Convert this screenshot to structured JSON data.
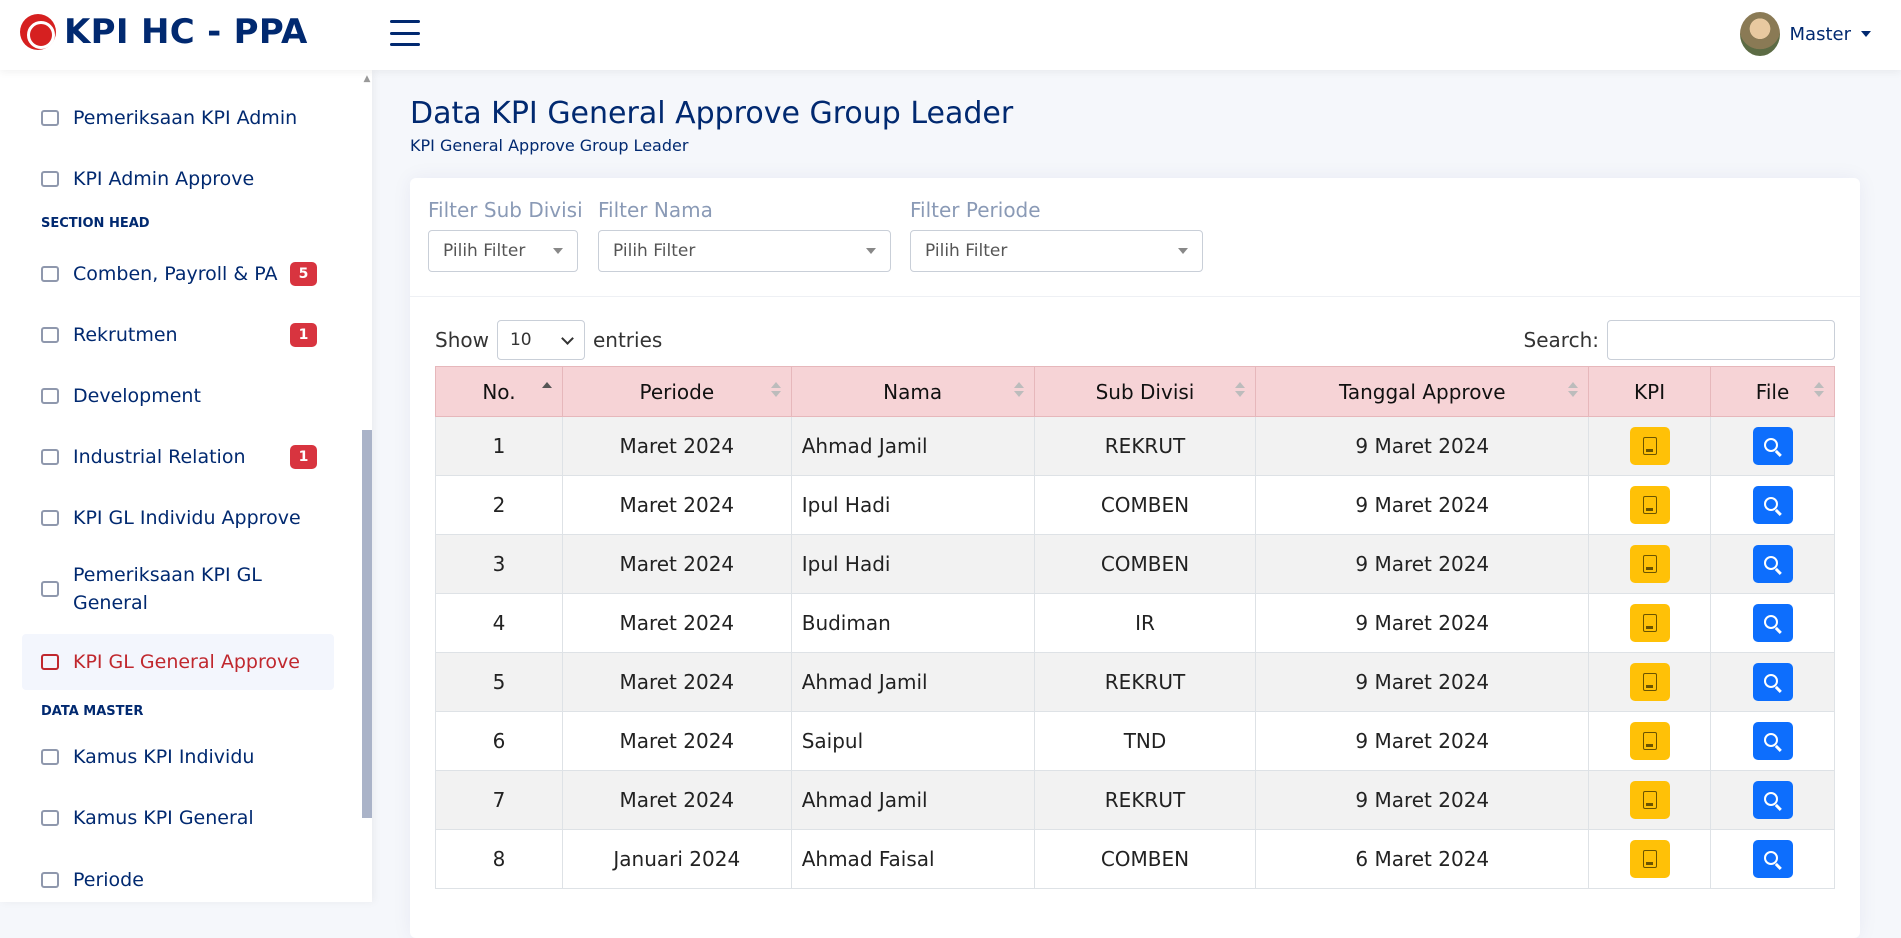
{
  "app": {
    "title": "KPI HC - PPA"
  },
  "user": {
    "name": "Master"
  },
  "sidebar": {
    "items": [
      {
        "label": "Pemeriksaan KPI Admin"
      },
      {
        "label": "KPI Admin Approve"
      },
      {
        "label": "Comben, Payroll & PA",
        "badge": "5"
      },
      {
        "label": "Rekrutmen",
        "badge": "1"
      },
      {
        "label": "Development"
      },
      {
        "label": "Industrial Relation",
        "badge": "1"
      },
      {
        "label": "KPI GL Individu Approve"
      },
      {
        "label": "Pemeriksaan KPI GL General"
      },
      {
        "label": "KPI GL General Approve"
      },
      {
        "label": "Kamus KPI Individu"
      },
      {
        "label": "Kamus KPI General"
      },
      {
        "label": "Periode"
      }
    ],
    "sections": {
      "section_head": "SECTION HEAD",
      "data_master": "DATA MASTER"
    },
    "active_color": "#c0282e"
  },
  "page": {
    "title": "Data KPI General Approve Group Leader",
    "subtitle": "KPI General Approve Group Leader"
  },
  "filters": {
    "sub_divisi": {
      "label": "Filter Sub Divisi",
      "value": "Pilih Filter"
    },
    "nama": {
      "label": "Filter Nama",
      "value": "Pilih Filter"
    },
    "periode": {
      "label": "Filter Periode",
      "value": "Pilih Filter"
    }
  },
  "table_controls": {
    "show_label": "Show",
    "entries_value": "10",
    "entries_label": "entries",
    "search_label": "Search:"
  },
  "table": {
    "columns": [
      "No.",
      "Periode",
      "Nama",
      "Sub Divisi",
      "Tanggal Approve",
      "KPI",
      "File"
    ],
    "rows": [
      {
        "no": "1",
        "periode": "Maret 2024",
        "nama": "Ahmad Jamil",
        "sub": "REKRUT",
        "tanggal": "9 Maret 2024"
      },
      {
        "no": "2",
        "periode": "Maret 2024",
        "nama": "Ipul Hadi",
        "sub": "COMBEN",
        "tanggal": "9 Maret 2024"
      },
      {
        "no": "3",
        "periode": "Maret 2024",
        "nama": "Ipul Hadi",
        "sub": "COMBEN",
        "tanggal": "9 Maret 2024"
      },
      {
        "no": "4",
        "periode": "Maret 2024",
        "nama": "Budiman",
        "sub": "IR",
        "tanggal": "9 Maret 2024"
      },
      {
        "no": "5",
        "periode": "Maret 2024",
        "nama": "Ahmad Jamil",
        "sub": "REKRUT",
        "tanggal": "9 Maret 2024"
      },
      {
        "no": "6",
        "periode": "Maret 2024",
        "nama": "Saipul",
        "sub": "TND",
        "tanggal": "9 Maret 2024"
      },
      {
        "no": "7",
        "periode": "Maret 2024",
        "nama": "Ahmad Jamil",
        "sub": "REKRUT",
        "tanggal": "9 Maret 2024"
      },
      {
        "no": "8",
        "periode": "Januari 2024",
        "nama": "Ahmad Faisal",
        "sub": "COMBEN",
        "tanggal": "6 Maret 2024"
      }
    ]
  },
  "colors": {
    "brand": "#012970",
    "header_bg": "#f6d3d6",
    "kpi_button": "#ffc107",
    "file_button": "#0d6efd",
    "badge": "#d8343f"
  }
}
